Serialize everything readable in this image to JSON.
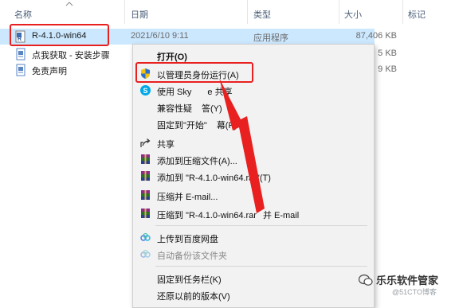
{
  "columns": {
    "name": "名称",
    "date": "日期",
    "type": "类型",
    "size": "大小",
    "tags": "标记"
  },
  "files": [
    {
      "name": "R-4.1.0-win64",
      "date": "2021/6/10 9:11",
      "type": "应用程序",
      "size": "87,406 KB"
    },
    {
      "name": "点我获取 - 安装步骤",
      "size_partial": "5 KB"
    },
    {
      "name": "免责声明",
      "size_partial": "9 KB"
    }
  ],
  "menu": {
    "open": "打开(O)",
    "run_as_admin": "以管理员身份运行(A)",
    "skype_share_pre": "使用 Sky",
    "skype_share_post": "e 共享",
    "compat_pre": "兼容性疑",
    "compat_post": "答(Y)",
    "pin_start_pre": "固定到\"开始\"",
    "pin_start_post": "幕(P)",
    "share": "共享",
    "add_archive": "添加到压缩文件(A)...",
    "add_to_rar": "添加到 \"R-4.1.0-win64.rar\"(T)",
    "compress_email": "压缩并 E-mail...",
    "compress_rar_email_pre": "压缩到 \"R-4.1.0-win64.rar",
    "compress_rar_email_post": "并 E-mail",
    "upload_baidu": "上传到百度网盘",
    "auto_backup": "自动备份该文件夹",
    "pin_taskbar": "固定到任务栏(K)",
    "restore_prev": "还原以前的版本(V)"
  },
  "watermark": {
    "title": "乐乐软件管家",
    "sub": "@51CTO博客"
  },
  "colors": {
    "highlight_red": "#e8201f",
    "selection_blue": "#cce8ff",
    "menu_bg": "#f2f2f2"
  }
}
